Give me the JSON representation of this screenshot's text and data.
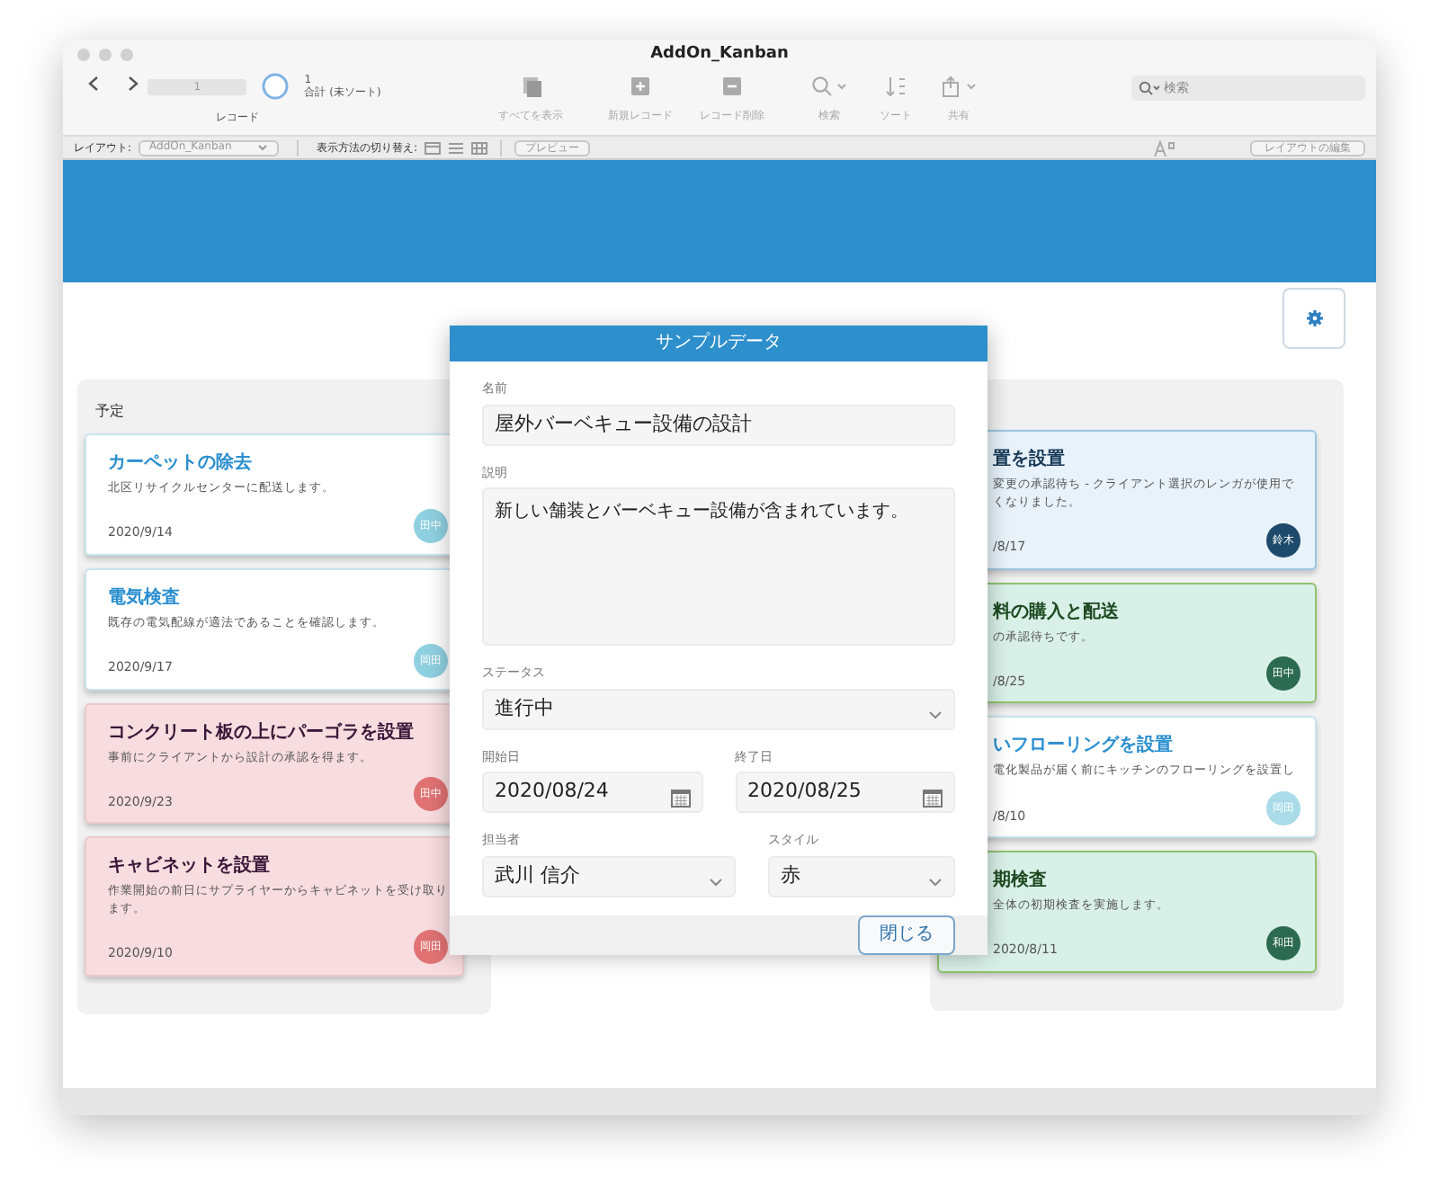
{
  "window": {
    "title": "AddOn_Kanban"
  },
  "toolbar": {
    "record_number": "1",
    "record_count": "1",
    "found_status": "合計 (未ソート)",
    "record_label": "レコード",
    "buttons": [
      {
        "kind": "show-all",
        "label": "すべてを表示",
        "disabled": true
      },
      {
        "kind": "new",
        "label": "新規レコード",
        "disabled": true
      },
      {
        "kind": "delete",
        "label": "レコード削除",
        "disabled": true
      },
      {
        "kind": "search",
        "label": "検索",
        "disabled": true
      },
      {
        "kind": "sort",
        "label": "ソート",
        "disabled": true
      },
      {
        "kind": "share",
        "label": "共有",
        "disabled": true
      }
    ],
    "search": {
      "placeholder": "検索"
    }
  },
  "layout_bar": {
    "layout_label": "レイアウト:",
    "layout_value": "AddOn_Kanban",
    "view_label": "表示方法の切り替え:",
    "preview_button": "プレビュー",
    "edit_button": "レイアウトの編集"
  },
  "board": {
    "columns": [
      {
        "title": "予定",
        "cards": [
          {
            "kind": "white",
            "title": "カーペットの除去",
            "description": "北区リサイクルセンターに配送します。",
            "date": "2020/9/14",
            "assignee": "田中",
            "color": "#8fd0e0"
          },
          {
            "kind": "white",
            "title": "電気検査",
            "description": "既存の電気配線が適法であることを確認します。",
            "date": "2020/9/17",
            "assignee": "岡田",
            "color": "#8fd0e0"
          },
          {
            "kind": "red",
            "title": "コンクリート板の上にパーゴラを設置",
            "description": "事前にクライアントから設計の承認を得ます。",
            "date": "2020/9/23",
            "assignee": "田中",
            "color": "#e07272"
          },
          {
            "kind": "red",
            "title": "キャビネットを設置",
            "description": "作業開始の前日にサプライヤーからキャビネットを受け取ります。",
            "date": "2020/9/10",
            "assignee": "岡田",
            "color": "#e07272"
          }
        ]
      },
      {
        "cards": [
          {
            "kind": "blue",
            "title": "置を設置",
            "description": "変更の承認待ち - クライアント選択のレンガが使用でくなりました。",
            "date": "/8/17",
            "assignee": "鈴木",
            "color": "#1d4a6b"
          },
          {
            "kind": "green",
            "title": "料の購入と配送",
            "description": "の承認待ちです。",
            "date": "/8/25",
            "assignee": "田中",
            "color": "#2c6a52"
          },
          {
            "kind": "white",
            "title": "いフローリングを設置",
            "description": "電化製品が届く前にキッチンのフローリングを設置し",
            "date": "/8/10",
            "assignee": "岡田",
            "color": "#a9dbe8"
          },
          {
            "kind": "green",
            "title": "期検査",
            "description": "全体の初期検査を実施します。",
            "date": "2020/8/11",
            "assignee": "和田",
            "color": "#2c6a52"
          }
        ]
      }
    ]
  },
  "dialog": {
    "title": "サンプルデータ",
    "rows": [
      [
        {
          "kind": "text",
          "label": "名前",
          "value": "屋外バーベキュー設備の設計"
        }
      ],
      [
        {
          "kind": "textarea",
          "label": "説明",
          "value": "新しい舗装とバーベキュー設備が含まれています。"
        }
      ],
      [
        {
          "kind": "select",
          "label": "ステータス",
          "value": "進行中"
        }
      ],
      [
        {
          "kind": "date",
          "label": "開始日",
          "value": "2020/08/24"
        },
        {
          "kind": "date",
          "label": "終了日",
          "value": "2020/08/25"
        }
      ],
      [
        {
          "kind": "select",
          "label": "担当者",
          "value": "武川 信介"
        },
        {
          "kind": "select",
          "label": "スタイル",
          "value": "赤"
        }
      ]
    ],
    "close_button": "閉じる"
  }
}
